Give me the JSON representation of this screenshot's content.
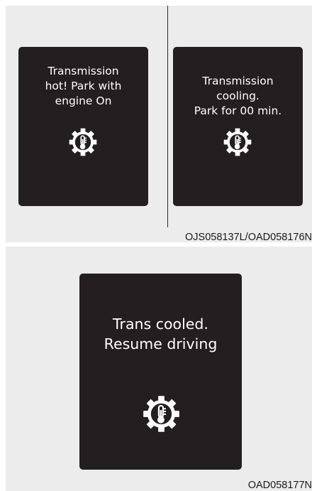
{
  "figure_top": {
    "screens": [
      {
        "lines": [
          "Transmission",
          "hot! Park with",
          "engine On"
        ],
        "icon": "transmission-temperature-gear-icon"
      },
      {
        "lines": [
          "Transmission",
          "cooling.",
          "Park for 00 min."
        ],
        "icon": "transmission-temperature-gear-icon"
      }
    ],
    "code": "OJS058137L/OAD058176N"
  },
  "figure_bottom": {
    "screen": {
      "lines": [
        "Trans cooled.",
        "Resume driving"
      ],
      "icon": "transmission-temperature-gear-icon"
    },
    "code": "OAD058177N"
  },
  "colors": {
    "screen_bg": "#231f20",
    "panel_bg": "#ececec",
    "text": "#ffffff"
  }
}
